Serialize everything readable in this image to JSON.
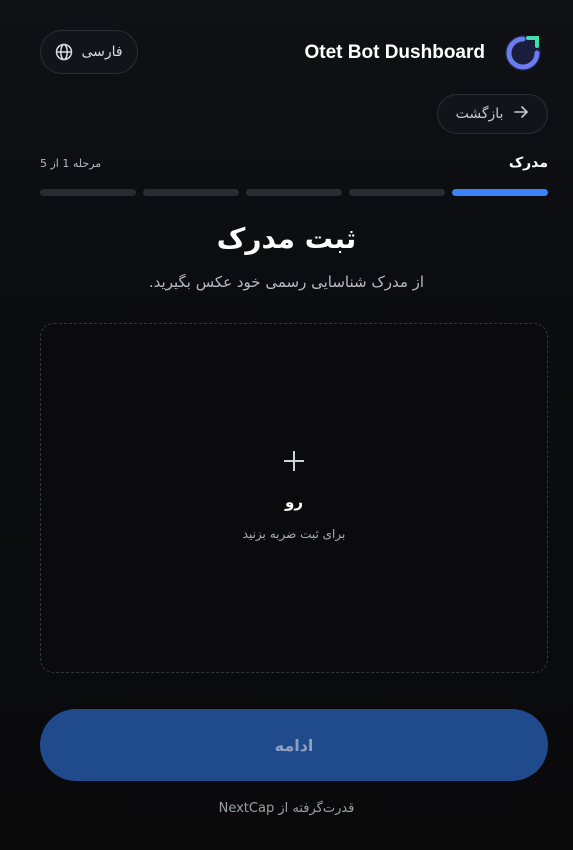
{
  "header": {
    "brand_name": "Otet Bot Dushboard",
    "language_label": "فارسی",
    "logo_icon": "ring-logo-icon",
    "globe_icon": "globe-icon"
  },
  "nav": {
    "back_label": "بازگشت",
    "back_icon": "arrow-right-icon"
  },
  "steps": {
    "current_name": "مدرک",
    "counter": "مرحله 1 از 5",
    "total": 5,
    "active_index": 0
  },
  "main": {
    "title": "ثبت مدرک",
    "subtitle": "از مدرک شناسایی رسمی خود عکس بگیرید.",
    "upload": {
      "label": "رو",
      "hint": "برای ثبت ضربه بزنید",
      "icon": "plus-icon"
    },
    "continue_label": "ادامه"
  },
  "footer": {
    "text": "قدرت‌گرفته از NextCap"
  },
  "colors": {
    "accent": "#3b82f6",
    "button_bg": "#1f4a8c",
    "background": "#0b0c0f"
  }
}
